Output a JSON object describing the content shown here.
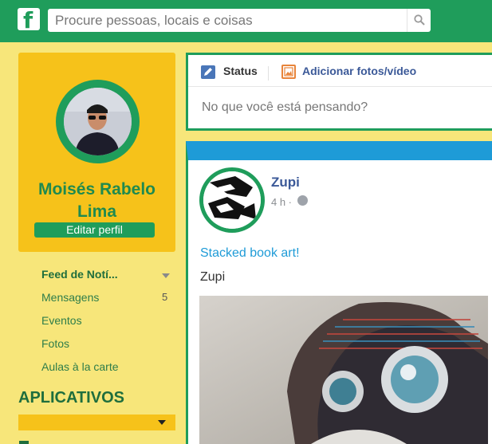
{
  "header": {
    "logo_letter": "f",
    "search_placeholder": "Procure pessoas, locais e coisas"
  },
  "profile": {
    "name": "Moisés Rabelo Lima",
    "edit_label": "Editar perfil"
  },
  "sidebar": {
    "items": [
      {
        "label": "Feed de Notí...",
        "active": true
      },
      {
        "label": "Mensagens",
        "count": "5"
      },
      {
        "label": "Eventos"
      },
      {
        "label": "Fotos"
      },
      {
        "label": "Aulas à la carte"
      }
    ],
    "apps_title": "APLICATIVOS"
  },
  "composer": {
    "status_label": "Status",
    "photo_label": "Adicionar fotos/vídeo",
    "placeholder": "No que você está pensando?"
  },
  "post": {
    "author": "Zupi",
    "time": "4 h ·",
    "link_title": "Stacked book art!",
    "text": "Zupi"
  },
  "colors": {
    "brand_green": "#1f9d5b",
    "page_yellow": "#f7e67a",
    "card_yellow": "#f6c21a",
    "post_blue": "#1e9bd7",
    "link_blue": "#3b5998"
  },
  "icons": [
    "facebook-logo-icon",
    "search-icon",
    "status-pencil-icon",
    "photo-icon",
    "globe-icon",
    "chevron-down-icon"
  ]
}
